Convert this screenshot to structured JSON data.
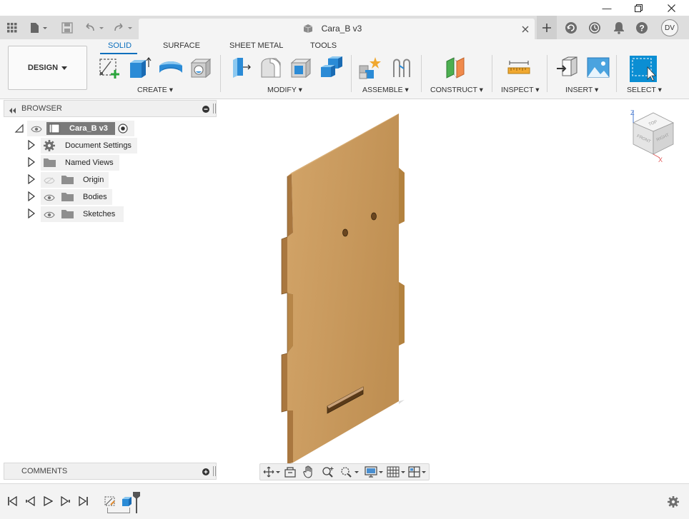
{
  "document": {
    "title": "Cara_B v3"
  },
  "user": {
    "initials": "DV"
  },
  "workspace": {
    "label": "DESIGN"
  },
  "ribbon": {
    "tabs": [
      {
        "label": "SOLID",
        "active": true
      },
      {
        "label": "SURFACE",
        "active": false
      },
      {
        "label": "SHEET METAL",
        "active": false
      },
      {
        "label": "TOOLS",
        "active": false
      }
    ],
    "groups": {
      "create": "CREATE",
      "modify": "MODIFY",
      "assemble": "ASSEMBLE",
      "construct": "CONSTRUCT",
      "inspect": "INSPECT",
      "insert": "INSERT",
      "select": "SELECT"
    }
  },
  "browser": {
    "title": "BROWSER",
    "root": "Cara_B v3",
    "items": [
      {
        "label": "Document Settings",
        "icon": "gear-icon"
      },
      {
        "label": "Named Views",
        "icon": "folder-icon"
      },
      {
        "label": "Origin",
        "icon": "folder-icon",
        "hidden": true
      },
      {
        "label": "Bodies",
        "icon": "folder-icon"
      },
      {
        "label": "Sketches",
        "icon": "folder-icon"
      }
    ]
  },
  "comments": {
    "title": "COMMENTS"
  },
  "viewcube": {
    "axis_z": "Z",
    "axis_x": "X",
    "face_top": "TOP",
    "face_front": "FRONT",
    "face_right": "RIGHT"
  },
  "colors": {
    "accent": "#0b6fbd",
    "wood": "#c99a5e",
    "wood_edge": "#a9773f"
  }
}
